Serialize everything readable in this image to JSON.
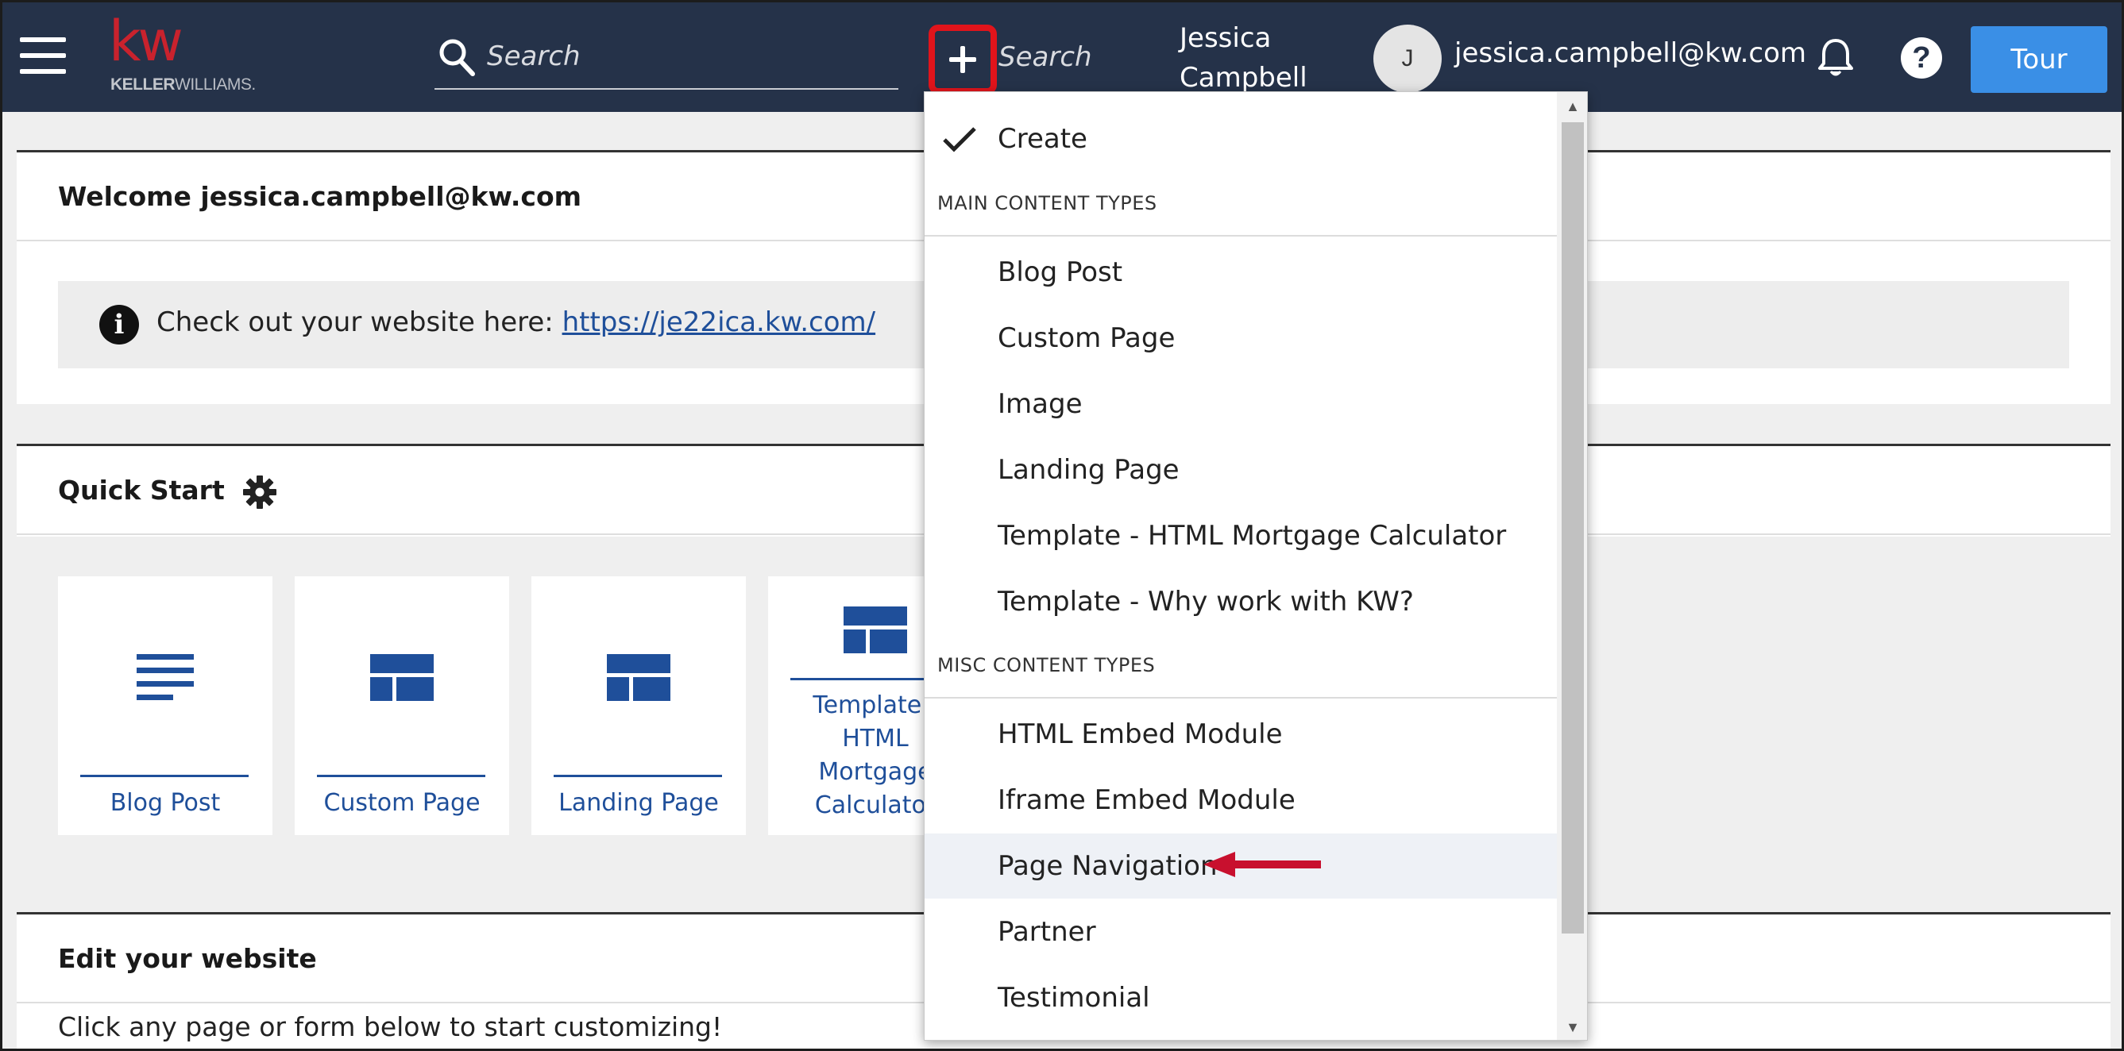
{
  "header": {
    "brand": {
      "logo_mark": "kw",
      "logo_sub_bold": "KELLER",
      "logo_sub_rest": "WILLIAMS."
    },
    "search": {
      "placeholder": "Search"
    },
    "create_search": {
      "placeholder": "Search"
    },
    "user": {
      "name_line1": "Jessica",
      "name_line2": "Campbell",
      "avatar_initial": "J",
      "email": "jessica.campbell@kw.com"
    },
    "help_glyph": "?",
    "tour_label": "Tour"
  },
  "welcome": {
    "title": "Welcome jessica.campbell@kw.com",
    "notice_text": "Check out your website here:",
    "notice_link": "https://je22ica.kw.com/",
    "info_glyph": "i"
  },
  "quick_start": {
    "title": "Quick Start",
    "cards": [
      {
        "label": "Blog Post",
        "icon": "lines-icon"
      },
      {
        "label": "Custom Page",
        "icon": "layout-icon"
      },
      {
        "label": "Landing Page",
        "icon": "layout-icon"
      },
      {
        "label_lines": [
          "Template -",
          "HTML",
          "Mortgage",
          "Calculator"
        ],
        "icon": "layout-icon"
      }
    ]
  },
  "edit": {
    "title": "Edit your website",
    "subtitle": "Click any page or form below to start customizing!"
  },
  "dropdown": {
    "selected": "Create",
    "main_header": "MAIN CONTENT TYPES",
    "main_items": [
      "Blog Post",
      "Custom Page",
      "Image",
      "Landing Page",
      "Template - HTML Mortgage Calculator",
      "Template - Why work with KW?"
    ],
    "misc_header": "MISC CONTENT TYPES",
    "misc_items": [
      "HTML Embed Module",
      "Iframe Embed Module",
      "Page Navigation",
      "Partner",
      "Testimonial"
    ],
    "highlighted": "Page Navigation"
  },
  "colors": {
    "topbar": "#253249",
    "accent_red": "#e1141b",
    "brand_blue": "#1f4f9a",
    "tour_blue": "#3a8fe6"
  }
}
